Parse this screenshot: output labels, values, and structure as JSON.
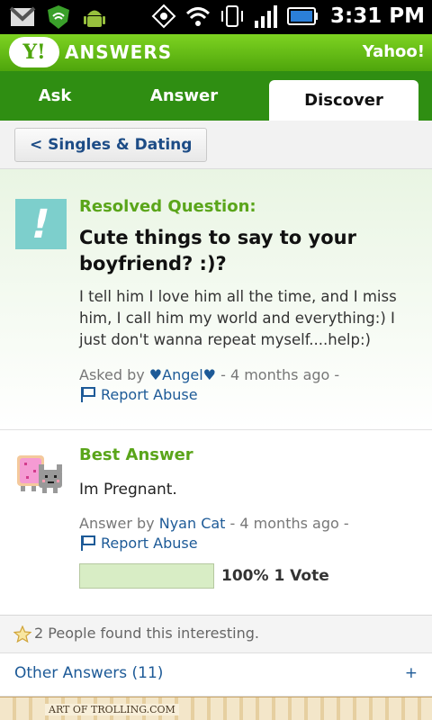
{
  "status_bar": {
    "left_icons": [
      "gmail-icon",
      "shield-icon",
      "android-icon"
    ],
    "right_icons": [
      "gps-icon",
      "wifi-icon",
      "vibrate-icon",
      "signal-icon",
      "battery-icon"
    ],
    "time": "3:31 PM"
  },
  "header": {
    "logo_text": "Y!",
    "title": "ANSWERS",
    "brand": "Yahoo!"
  },
  "tabs": [
    {
      "label": "Ask",
      "active": false
    },
    {
      "label": "Answer",
      "active": false
    },
    {
      "label": "Discover",
      "active": true
    }
  ],
  "breadcrumb": {
    "label": "< Singles & Dating"
  },
  "question": {
    "status": "Resolved Question:",
    "title": "Cute things to say to your boyfriend? :)?",
    "body": "I tell him I love him all the time, and I miss him, I call him my world and everything:) I just don't wanna repeat myself....help:)",
    "asked_prefix": "Asked by",
    "user": "♥Angel♥",
    "time": "- 4 months ago -",
    "report": "Report Abuse",
    "icon_glyph": "!"
  },
  "best_answer": {
    "heading": "Best Answer",
    "body": "Im Pregnant.",
    "answer_prefix": "Answer by",
    "user": "Nyan Cat",
    "time": "- 4 months ago -",
    "report": "Report Abuse",
    "vote_fraction": 1.0,
    "vote_text": "100% 1 Vote"
  },
  "interesting": {
    "text": "2 People found this interesting."
  },
  "other_answers": {
    "label": "Other Answers (11)",
    "expand": "+"
  },
  "footer": {
    "text": "ART OF TROLLING.COM"
  },
  "colors": {
    "yahoo_green": "#5aa51a",
    "tab_bar": "#2f8e12",
    "link_blue": "#1d5a97"
  }
}
